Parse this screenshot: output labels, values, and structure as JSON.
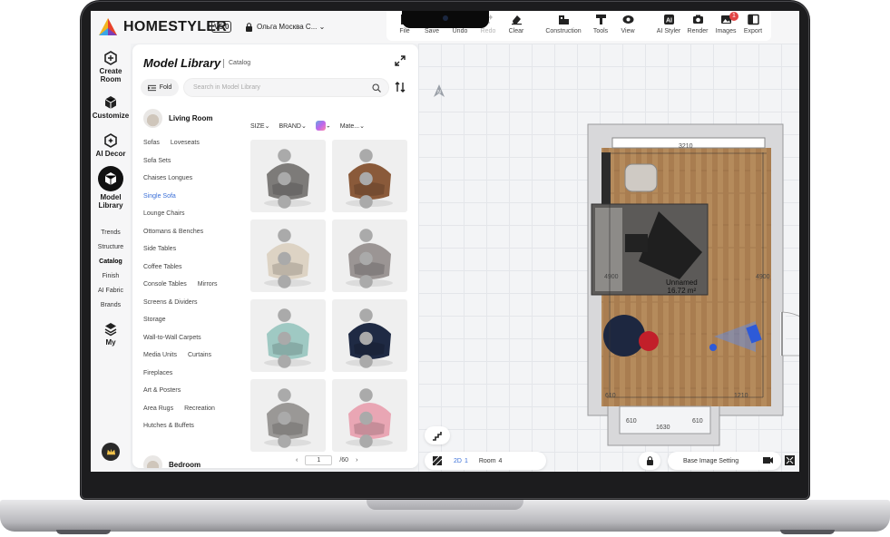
{
  "app": {
    "brand": "HOMESTYLER",
    "version": "V5.0",
    "project": "Ольга Москва С..."
  },
  "toolbar": [
    {
      "key": "file",
      "label": "File",
      "icon": "file-icon"
    },
    {
      "key": "save",
      "label": "Save",
      "icon": "save-icon"
    },
    {
      "key": "undo",
      "label": "Undo",
      "icon": "undo-icon"
    },
    {
      "key": "redo",
      "label": "Redo",
      "icon": "redo-icon",
      "disabled": true
    },
    {
      "key": "clear",
      "label": "Clear",
      "icon": "eraser-icon"
    },
    {
      "key": "construction",
      "label": "Construction",
      "icon": "construction-icon"
    },
    {
      "key": "tools",
      "label": "Tools",
      "icon": "tools-icon"
    },
    {
      "key": "view",
      "label": "View",
      "icon": "eye-icon"
    },
    {
      "key": "ai_styler",
      "label": "AI Styler",
      "icon": "ai-styler-icon"
    },
    {
      "key": "render",
      "label": "Render",
      "icon": "camera-icon"
    },
    {
      "key": "images",
      "label": "Images",
      "icon": "images-icon",
      "badge": "1"
    },
    {
      "key": "export",
      "label": "Export",
      "icon": "export-icon"
    }
  ],
  "rail": {
    "items": [
      {
        "label": "Create Room",
        "icon": "create-room-icon"
      },
      {
        "label": "Customize",
        "icon": "customize-icon"
      },
      {
        "label": "AI Decor",
        "icon": "ai-decor-icon"
      },
      {
        "label": "Model Library",
        "icon": "model-library-icon",
        "active": true
      },
      {
        "label": "My",
        "icon": "my-icon"
      }
    ],
    "subitems": [
      "Trends",
      "Structure",
      "Catalog",
      "Finish",
      "AI Fabric",
      "Brands"
    ],
    "active_sub": "Catalog"
  },
  "library": {
    "title": "Model Library",
    "subtitle": "Catalog",
    "fold_label": "Fold",
    "search_placeholder": "Search in Model Library",
    "category": "Living Room",
    "next_category": "Bedroom",
    "categories": [
      [
        "Sofas",
        "Loveseats"
      ],
      [
        "Sofa Sets"
      ],
      [
        "Chaises Longues"
      ],
      [
        "Single Sofa"
      ],
      [
        "Lounge Chairs"
      ],
      [
        "Ottomans & Benches"
      ],
      [
        "Side Tables"
      ],
      [
        "Coffee Tables"
      ],
      [
        "Console Tables",
        "Mirrors"
      ],
      [
        "Screens & Dividers"
      ],
      [
        "Storage"
      ],
      [
        "Wall-to-Wall Carpets"
      ],
      [
        "Media Units",
        "Curtains"
      ],
      [
        "Fireplaces"
      ],
      [
        "Art & Posters"
      ],
      [
        "Area Rugs",
        "Recreation"
      ],
      [
        "Hutches & Buffets"
      ]
    ],
    "active_category": "Single Sofa",
    "filters": {
      "size": "SIZE",
      "brand": "BRAND",
      "material": "Mate..."
    },
    "models": [
      {
        "name": "grey-bowl-chair",
        "color": "#7d7b79"
      },
      {
        "name": "brown-leather-armchair",
        "color": "#8a5a3a"
      },
      {
        "name": "cream-tufted-chair",
        "color": "#ddd3c4"
      },
      {
        "name": "grey-velvet-armchair",
        "color": "#9b9594"
      },
      {
        "name": "teal-leather-recliner",
        "color": "#9fc9c3"
      },
      {
        "name": "navy-wingback-chair",
        "color": "#1f2a44"
      },
      {
        "name": "grey-round-sofa",
        "color": "#9a9896"
      },
      {
        "name": "pink-shell-chair",
        "color": "#e9a6b4"
      }
    ],
    "pager": {
      "page": "1",
      "total": "/60"
    }
  },
  "canvas": {
    "room_name": "Unnamed",
    "room_area": "16.72 m²",
    "dims": {
      "top": "3210",
      "left": "4900",
      "right": "4900",
      "bottom_left": "610",
      "bottom_right": "1210",
      "bump_left": "610",
      "bump_mid": "1630",
      "bump_right": "610"
    },
    "bottom": {
      "mode": "2D",
      "mode_num": "1",
      "room": "Room",
      "room_num": "4",
      "base_image": "Base Image Setting"
    }
  }
}
